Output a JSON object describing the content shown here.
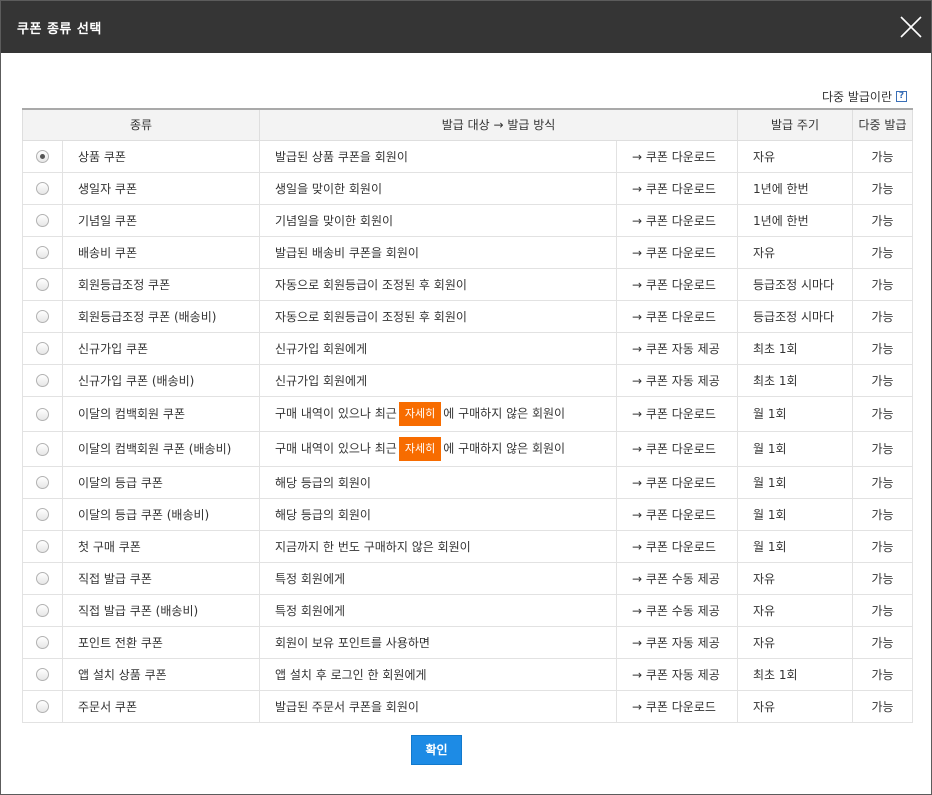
{
  "dialog": {
    "title": "쿠폰 종류 선택",
    "help_link": "다중 발급이란",
    "help_icon": "question-icon",
    "close_icon": "close-icon",
    "confirm_label": "확인",
    "colors": {
      "titlebar": "#353535",
      "download": "#c7161d",
      "auto": "#2b6aa0",
      "detail_button": "#f76c00",
      "confirm_button": "#1d8be5"
    }
  },
  "table": {
    "headers": {
      "type": "종류",
      "target": "발급 대상 → 발급 방식",
      "cycle": "발급 주기",
      "multiple": "다중 발급"
    },
    "rows": [
      {
        "name": "상품 쿠폰",
        "target": "발급된 상품 쿠폰을 회원이",
        "method": "→ 쿠폰 다운로드",
        "method_kind": "download",
        "cycle": "자유",
        "multiple": "가능",
        "selected": true
      },
      {
        "name": "생일자 쿠폰",
        "target": "생일을 맞이한 회원이",
        "method": "→ 쿠폰 다운로드",
        "method_kind": "download",
        "cycle": "1년에 한번",
        "multiple": "가능",
        "selected": false
      },
      {
        "name": "기념일 쿠폰",
        "target": "기념일을 맞이한 회원이",
        "method": "→ 쿠폰 다운로드",
        "method_kind": "download",
        "cycle": "1년에 한번",
        "multiple": "가능",
        "selected": false
      },
      {
        "name": "배송비 쿠폰",
        "target": "발급된 배송비 쿠폰을 회원이",
        "method": "→ 쿠폰 다운로드",
        "method_kind": "download",
        "cycle": "자유",
        "multiple": "가능",
        "selected": false
      },
      {
        "name": "회원등급조정 쿠폰",
        "target": "자동으로 회원등급이 조정된 후 회원이",
        "method": "→ 쿠폰 다운로드",
        "method_kind": "download",
        "cycle": "등급조정 시마다",
        "multiple": "가능",
        "selected": false
      },
      {
        "name": "회원등급조정 쿠폰 (배송비)",
        "target": "자동으로 회원등급이 조정된 후 회원이",
        "method": "→ 쿠폰 다운로드",
        "method_kind": "download",
        "cycle": "등급조정 시마다",
        "multiple": "가능",
        "selected": false
      },
      {
        "name": "신규가입 쿠폰",
        "target": "신규가입 회원에게",
        "method": "→ 쿠폰 자동 제공",
        "method_kind": "auto",
        "cycle": "최초 1회",
        "multiple": "가능",
        "selected": false
      },
      {
        "name": "신규가입 쿠폰 (배송비)",
        "target": "신규가입 회원에게",
        "method": "→ 쿠폰 자동 제공",
        "method_kind": "auto",
        "cycle": "최초 1회",
        "multiple": "가능",
        "selected": false
      },
      {
        "name": "이달의 컴백회원 쿠폰",
        "target_pre": "구매 내역이 있으나 최근",
        "detail_label": "자세히",
        "target_post": "에 구매하지 않은 회원이",
        "method": "→ 쿠폰 다운로드",
        "method_kind": "download",
        "cycle": "월 1회",
        "multiple": "가능",
        "selected": false
      },
      {
        "name": "이달의 컴백회원 쿠폰 (배송비)",
        "target_pre": "구매 내역이 있으나 최근",
        "detail_label": "자세히",
        "target_post": "에 구매하지 않은 회원이",
        "method": "→ 쿠폰 다운로드",
        "method_kind": "download",
        "cycle": "월 1회",
        "multiple": "가능",
        "selected": false
      },
      {
        "name": "이달의 등급 쿠폰",
        "target": "해당 등급의 회원이",
        "method": "→ 쿠폰 다운로드",
        "method_kind": "download",
        "cycle": "월 1회",
        "multiple": "가능",
        "selected": false
      },
      {
        "name": "이달의 등급 쿠폰 (배송비)",
        "target": "해당 등급의 회원이",
        "method": "→ 쿠폰 다운로드",
        "method_kind": "download",
        "cycle": "월 1회",
        "multiple": "가능",
        "selected": false
      },
      {
        "name": "첫 구매 쿠폰",
        "target": "지금까지 한 번도 구매하지 않은 회원이",
        "method": "→ 쿠폰 다운로드",
        "method_kind": "download",
        "cycle": "월 1회",
        "multiple": "가능",
        "selected": false
      },
      {
        "name": "직접 발급 쿠폰",
        "target": "특정 회원에게",
        "method": "→ 쿠폰 수동 제공",
        "method_kind": "auto",
        "cycle": "자유",
        "multiple": "가능",
        "selected": false
      },
      {
        "name": "직접 발급 쿠폰 (배송비)",
        "target": "특정 회원에게",
        "method": "→ 쿠폰 수동 제공",
        "method_kind": "auto",
        "cycle": "자유",
        "multiple": "가능",
        "selected": false
      },
      {
        "name": "포인트 전환 쿠폰",
        "target": "회원이 보유 포인트를 사용하면",
        "method": "→ 쿠폰 자동 제공",
        "method_kind": "auto",
        "cycle": "자유",
        "multiple": "가능",
        "selected": false
      },
      {
        "name": "앱 설치 상품 쿠폰",
        "target": "앱 설치 후 로그인 한 회원에게",
        "method": "→ 쿠폰 자동 제공",
        "method_kind": "auto",
        "cycle": "최초 1회",
        "multiple": "가능",
        "selected": false
      },
      {
        "name": "주문서 쿠폰",
        "target": "발급된 주문서 쿠폰을 회원이",
        "method": "→ 쿠폰 다운로드",
        "method_kind": "download",
        "cycle": "자유",
        "multiple": "가능",
        "selected": false
      }
    ]
  }
}
